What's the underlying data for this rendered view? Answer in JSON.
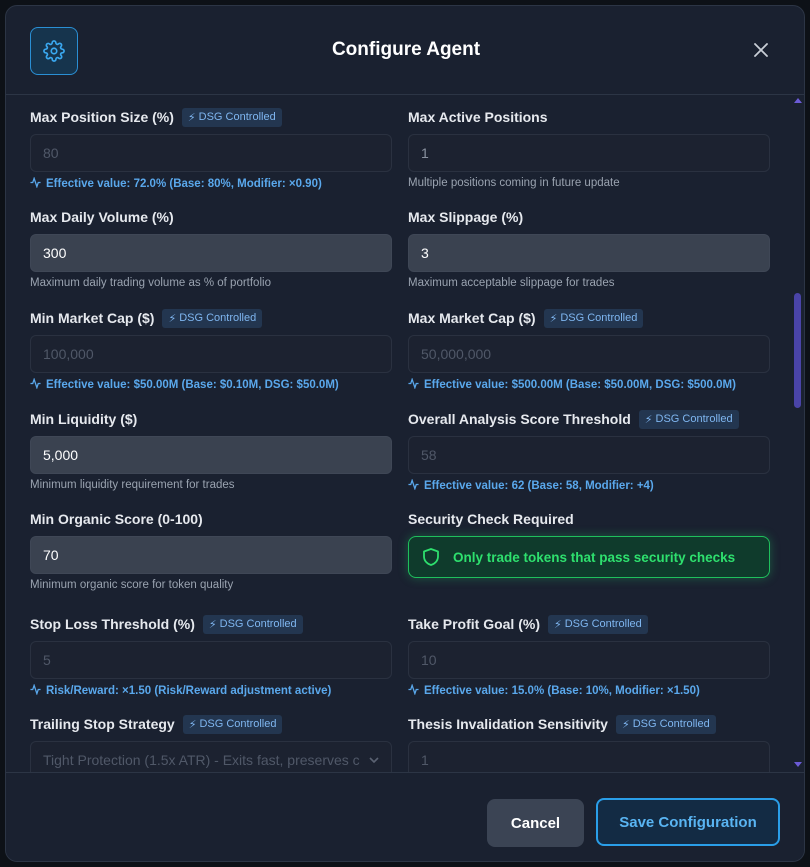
{
  "header": {
    "title": "Configure Agent",
    "gear_icon": "gear-icon",
    "close_icon": "close-icon"
  },
  "colors": {
    "accent": "#2a9ee8",
    "effective_text": "#5aa8ec",
    "security_green": "#2ee06e",
    "scroll_thumb": "#4a44a8"
  },
  "badge_label": "DSG Controlled",
  "fields": {
    "max_position_size": {
      "label": "Max Position Size (%)",
      "value": "80",
      "effective": "Effective value: 72.0% (Base: 80%, Modifier: ×0.90)"
    },
    "max_active_positions": {
      "label": "Max Active Positions",
      "value": "1",
      "help": "Multiple positions coming in future update"
    },
    "max_daily_volume": {
      "label": "Max Daily Volume (%)",
      "value": "300",
      "help": "Maximum daily trading volume as % of portfolio"
    },
    "max_slippage": {
      "label": "Max Slippage (%)",
      "value": "3",
      "help": "Maximum acceptable slippage for trades"
    },
    "min_market_cap": {
      "label": "Min Market Cap ($)",
      "value": "100,000",
      "effective": "Effective value: $50.00M (Base: $0.10M, DSG: $50.0M)"
    },
    "max_market_cap": {
      "label": "Max Market Cap ($)",
      "value": "50,000,000",
      "effective": "Effective value: $500.00M (Base: $50.00M, DSG: $500.0M)"
    },
    "min_liquidity": {
      "label": "Min Liquidity ($)",
      "value": "5,000",
      "help": "Minimum liquidity requirement for trades"
    },
    "analysis_score": {
      "label": "Overall Analysis Score Threshold",
      "value": "58",
      "effective": "Effective value: 62 (Base: 58, Modifier: +4)"
    },
    "min_organic_score": {
      "label": "Min Organic Score (0-100)",
      "value": "70",
      "help": "Minimum organic score for token quality"
    },
    "security_check": {
      "label": "Security Check Required",
      "text": "Only trade tokens that pass security checks",
      "icon": "shield-icon"
    },
    "stop_loss": {
      "label": "Stop Loss Threshold (%)",
      "value": "5",
      "effective": "Risk/Reward: ×1.50 (Risk/Reward adjustment active)"
    },
    "take_profit": {
      "label": "Take Profit Goal (%)",
      "value": "10",
      "effective": "Effective value: 15.0% (Base: 10%, Modifier: ×1.50)"
    },
    "trailing_stop": {
      "label": "Trailing Stop Strategy",
      "value": "Tight Protection (1.5x ATR) - Exits fast, preserves c"
    },
    "thesis_invalidation": {
      "label": "Thesis Invalidation Sensitivity",
      "value": "1"
    }
  },
  "footer": {
    "cancel_label": "Cancel",
    "save_label": "Save Configuration"
  }
}
